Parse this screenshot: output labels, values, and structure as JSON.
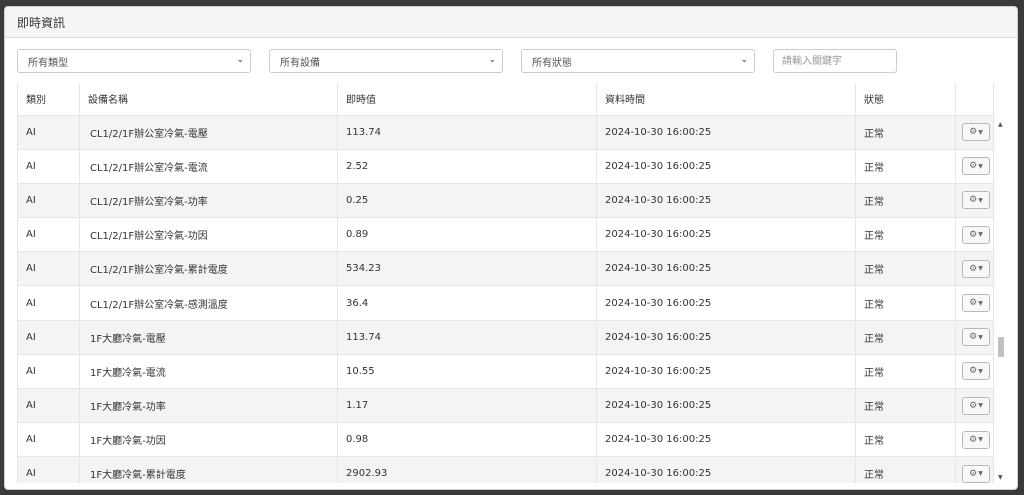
{
  "panel": {
    "title": "即時資訊"
  },
  "filters": {
    "type_select": "所有類型",
    "device_select": "所有設備",
    "status_select": "所有狀態",
    "keyword_placeholder": "請輸入關鍵字"
  },
  "table": {
    "headers": [
      "類別",
      "設備名稱",
      "即時值",
      "資料時間",
      "狀態"
    ],
    "rows": [
      {
        "type": "AI",
        "name": "CL1/2/1F辦公室冷氣-電壓",
        "value": "113.74",
        "time": "2024-10-30 16:00:25",
        "status": "正常"
      },
      {
        "type": "AI",
        "name": "CL1/2/1F辦公室冷氣-電流",
        "value": "2.52",
        "time": "2024-10-30 16:00:25",
        "status": "正常"
      },
      {
        "type": "AI",
        "name": "CL1/2/1F辦公室冷氣-功率",
        "value": "0.25",
        "time": "2024-10-30 16:00:25",
        "status": "正常"
      },
      {
        "type": "AI",
        "name": "CL1/2/1F辦公室冷氣-功因",
        "value": "0.89",
        "time": "2024-10-30 16:00:25",
        "status": "正常"
      },
      {
        "type": "AI",
        "name": "CL1/2/1F辦公室冷氣-累計電度",
        "value": "534.23",
        "time": "2024-10-30 16:00:25",
        "status": "正常"
      },
      {
        "type": "AI",
        "name": "CL1/2/1F辦公室冷氣-感測溫度",
        "value": "36.4",
        "time": "2024-10-30 16:00:25",
        "status": "正常"
      },
      {
        "type": "AI",
        "name": "1F大廳冷氣-電壓",
        "value": "113.74",
        "time": "2024-10-30 16:00:25",
        "status": "正常"
      },
      {
        "type": "AI",
        "name": "1F大廳冷氣-電流",
        "value": "10.55",
        "time": "2024-10-30 16:00:25",
        "status": "正常"
      },
      {
        "type": "AI",
        "name": "1F大廳冷氣-功率",
        "value": "1.17",
        "time": "2024-10-30 16:00:25",
        "status": "正常"
      },
      {
        "type": "AI",
        "name": "1F大廳冷氣-功因",
        "value": "0.98",
        "time": "2024-10-30 16:00:25",
        "status": "正常"
      },
      {
        "type": "AI",
        "name": "1F大廳冷氣-累計電度",
        "value": "2902.93",
        "time": "2024-10-30 16:00:25",
        "status": "正常"
      }
    ]
  },
  "icons": {
    "action": "gear-icon",
    "select_arrow": "chevron-down-icon"
  }
}
